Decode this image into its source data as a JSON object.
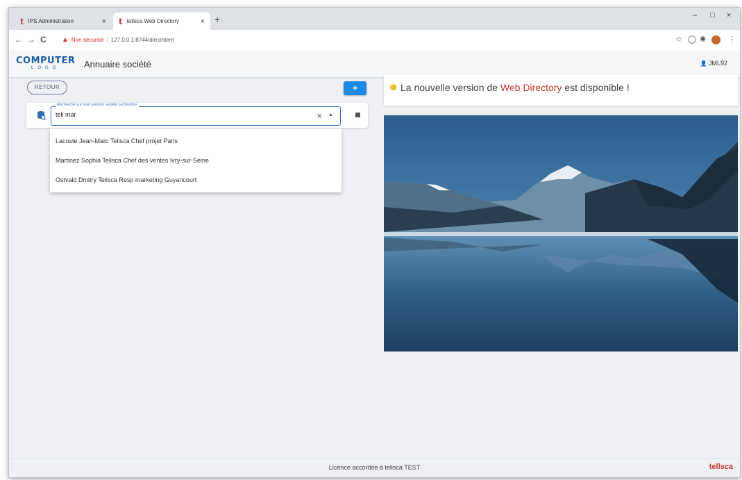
{
  "browser": {
    "tabs": [
      {
        "icon": "t",
        "title": "IPS Administration",
        "close": "×"
      },
      {
        "icon": "t",
        "title": "tellsca Web Directory",
        "close": "×"
      }
    ],
    "new_tab": "+",
    "window_controls": {
      "minimize": "–",
      "maximize": "□",
      "close": "×"
    },
    "nav": {
      "back": "←",
      "forward": "→",
      "reload": "C"
    },
    "address": {
      "warning_icon": "▲",
      "not_secure": "Non sécurisé",
      "separator": "|",
      "url": "127.0.0.1:8744/dircontent"
    },
    "extensions": {
      "star": "☆",
      "circle": "◯",
      "puzzle": "✱",
      "menu": "⋮"
    }
  },
  "header": {
    "logo_line1": "COMPUTER",
    "logo_line2": "LOGO",
    "title": "Annuaire société",
    "user_icon": "👤",
    "user": "JML92"
  },
  "left": {
    "back_label": "RETOUR",
    "add_label": "+",
    "search": {
      "label": "Recherche sur nom prénom société ou fonction",
      "value": "teli mar",
      "clear": "×",
      "caret": "▲"
    },
    "results": [
      "Lacoste Jean-Marc Telisca Chef projet Paris",
      "Martinez Sophia Telisca Chef des ventes Ivry-sur-Seine",
      "Ostvald Dmitry Telisca Resp marketing Guyancourt"
    ]
  },
  "notice": {
    "before": "La nouvelle version de",
    "brand": "Web Directory",
    "after": "est disponible !"
  },
  "footer": {
    "license": "Licence accordée à telisca TEST",
    "brand": "tellsca"
  },
  "colors": {
    "accent": "#1e88e5",
    "brand_red": "#c0392b",
    "logo_blue": "#1d5fa8"
  }
}
